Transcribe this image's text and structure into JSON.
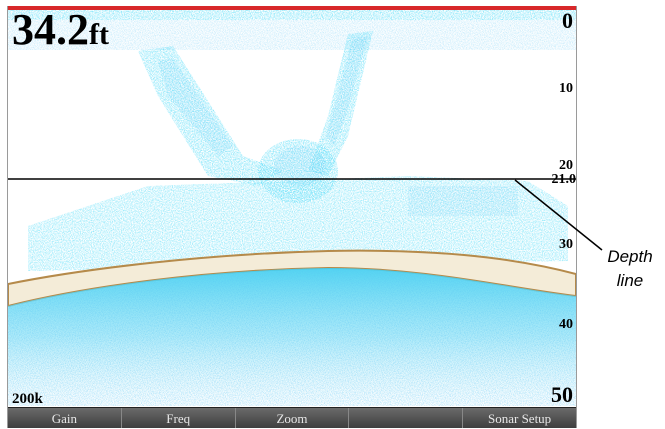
{
  "sonar": {
    "depth_value": "34.2",
    "depth_unit": "ft",
    "scale_labels": [
      "0",
      "10",
      "20",
      "30",
      "40",
      "50"
    ],
    "depth_line_value": "21.0",
    "frequency": "200k"
  },
  "softkeys": [
    "Gain",
    "Freq",
    "Zoom",
    "",
    "Sonar Setup"
  ],
  "callout": {
    "line1": "Depth",
    "line2": "line"
  },
  "colors": {
    "top_bar": "#d8282a",
    "bottom_echo": "#f4ecd8",
    "echo_blue": "#1e8fe0",
    "echo_cyan": "#3fd0f0",
    "echo_yellow": "#c8c830"
  }
}
